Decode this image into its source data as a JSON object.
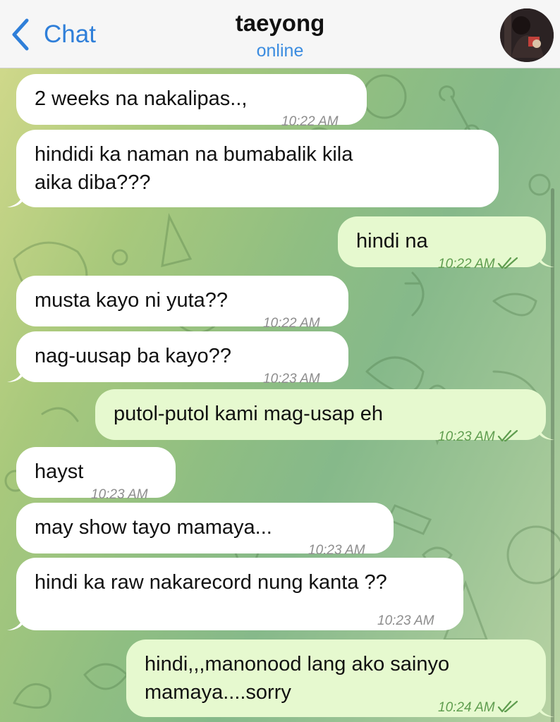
{
  "header": {
    "back_label": "Chat",
    "contact_name": "taeyong",
    "status": "online"
  },
  "messages": [
    {
      "dir": "in",
      "text": "2 weeks na nakalipas..,",
      "time": "10:22 AM"
    },
    {
      "dir": "in",
      "line1": "hindidi ka naman na bumabalik kila",
      "line2": "aika diba???",
      "time": "10:22 AM"
    },
    {
      "dir": "out",
      "text": "hindi na",
      "time": "10:22 AM",
      "read": true
    },
    {
      "dir": "in",
      "text": "musta kayo ni yuta??",
      "time": "10:22 AM"
    },
    {
      "dir": "in",
      "text": "nag-uusap ba kayo??",
      "time": "10:23 AM"
    },
    {
      "dir": "out",
      "text": "putol-putol kami mag-usap eh",
      "time": "10:23 AM",
      "read": true
    },
    {
      "dir": "in",
      "text": "hayst",
      "time": "10:23 AM"
    },
    {
      "dir": "in",
      "text": "may show tayo mamaya...",
      "time": "10:23 AM"
    },
    {
      "dir": "in",
      "text": "hindi ka raw nakarecord nung kanta ??",
      "time": "10:23 AM"
    },
    {
      "dir": "out",
      "line1": "hindi,,,manonood lang ako sainyo",
      "line2": "mamaya....sorry",
      "time": "10:24 AM",
      "read": true
    }
  ],
  "colors": {
    "accent": "#2f7fd9",
    "incoming_bubble": "#ffffff",
    "outgoing_bubble": "#e6f9cf",
    "outgoing_time": "#5f9d4f"
  }
}
